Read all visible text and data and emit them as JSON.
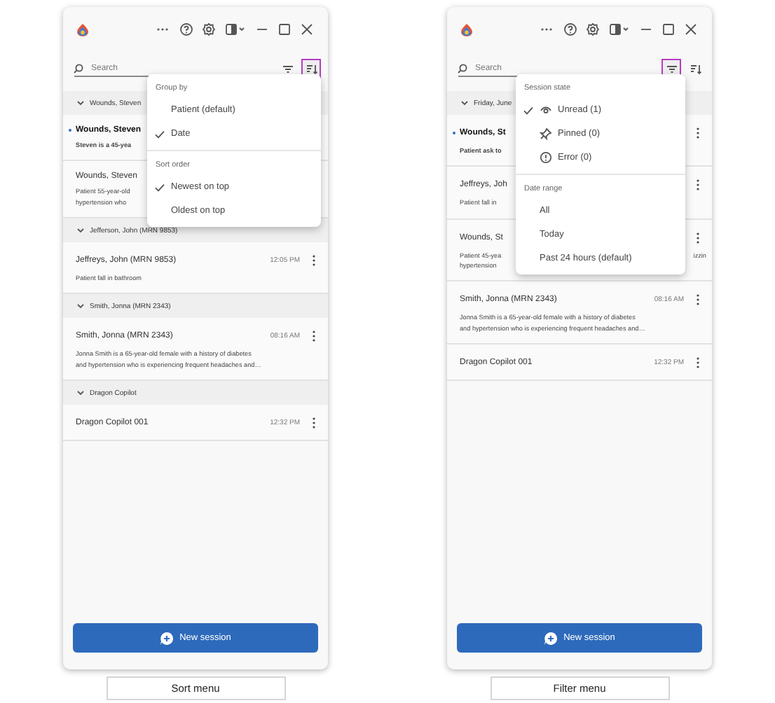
{
  "panels": [
    {
      "caption": "Sort menu",
      "tools": [
        {
          "kind": "filter",
          "highlighted": false
        },
        {
          "kind": "sort",
          "highlighted": true
        }
      ],
      "search": {
        "placeholder": "Search"
      },
      "groups": [
        {
          "title": "Wounds, Steven",
          "expanded": true,
          "items": [
            {
              "title": "Wounds, Steven",
              "unread": true,
              "summary_lines": [
                "Steven is a 45-yea"
              ],
              "more_button": false
            },
            {
              "title": "Wounds, Steven",
              "unread": false,
              "summary_lines": [
                "Patient 55-year-old",
                "hypertension who"
              ],
              "more_button": false
            }
          ]
        },
        {
          "title": "Jefferson, John (MRN 9853)",
          "expanded": true,
          "items": [
            {
              "title": "Jeffreys, John (MRN 9853)",
              "unread": false,
              "time": "12:05 PM",
              "summary_lines": [
                "Patient fall in bathroom"
              ],
              "more_button": true
            }
          ]
        },
        {
          "title": "Smith, Jonna (MRN 2343)",
          "expanded": true,
          "items": [
            {
              "title": "Smith, Jonna (MRN 2343)",
              "unread": false,
              "time": "08:16 AM",
              "summary_lines": [
                "Jonna Smith is a 65-year-old female with a history of diabetes",
                "and hypertension who is experiencing frequent headaches and…"
              ],
              "more_button": true
            }
          ]
        },
        {
          "title": "Dragon Copilot",
          "expanded": true,
          "items": [
            {
              "title": "Dragon Copilot 001",
              "unread": false,
              "time": "12:32 PM",
              "more_button": true
            }
          ]
        }
      ],
      "menu": {
        "kind": "sort",
        "sections": [
          {
            "title": "Group by",
            "options": [
              {
                "label": "Patient (default)",
                "checked": false
              },
              {
                "label": "Date",
                "checked": true
              }
            ]
          },
          {
            "title": "Sort order",
            "options": [
              {
                "label": "Newest on top",
                "checked": true
              },
              {
                "label": "Oldest on top",
                "checked": false
              }
            ]
          }
        ]
      },
      "new_session": "New session"
    },
    {
      "caption": "Filter menu",
      "tools": [
        {
          "kind": "filter",
          "highlighted": true
        },
        {
          "kind": "sort",
          "highlighted": false
        }
      ],
      "search": {
        "placeholder": "Search"
      },
      "groups": [
        {
          "title": "Friday, June",
          "expanded": true,
          "items": [
            {
              "title": "Wounds, St",
              "unread": true,
              "summary_lines": [
                "Patient ask to"
              ],
              "more_button": true
            },
            {
              "title": "Jeffreys, Joh",
              "unread": false,
              "summary_lines": [
                "Patient fall in"
              ],
              "more_button": true
            },
            {
              "title": "Wounds, St",
              "unread": false,
              "summary_lines": [
                "Patient 45-yea",
                "hypertension"
              ],
              "tail": "izzin",
              "more_button": true
            },
            {
              "title": "Smith, Jonna (MRN 2343)",
              "unread": false,
              "time": "08:16 AM",
              "summary_lines": [
                "Jonna Smith is a 65-year-old female with a history of diabetes",
                "and hypertension who is experiencing frequent headaches and…"
              ],
              "more_button": true
            },
            {
              "title": "Dragon Copilot 001",
              "unread": false,
              "time": "12:32 PM",
              "more_button": true
            }
          ]
        }
      ],
      "menu": {
        "kind": "filter",
        "sections": [
          {
            "title": "Session state",
            "options": [
              {
                "label": "Unread (1)",
                "kind": "unread",
                "checked": true
              },
              {
                "label": "Pinned (0)",
                "kind": "pinned",
                "checked": false
              },
              {
                "label": "Error (0)",
                "kind": "error",
                "checked": false
              }
            ]
          },
          {
            "title": "Date range",
            "options": [
              {
                "label": "All",
                "checked": false
              },
              {
                "label": "Today",
                "checked": false
              },
              {
                "label": "Past 24 hours (default)",
                "checked": false
              }
            ]
          }
        ]
      },
      "new_session": "New session"
    }
  ]
}
